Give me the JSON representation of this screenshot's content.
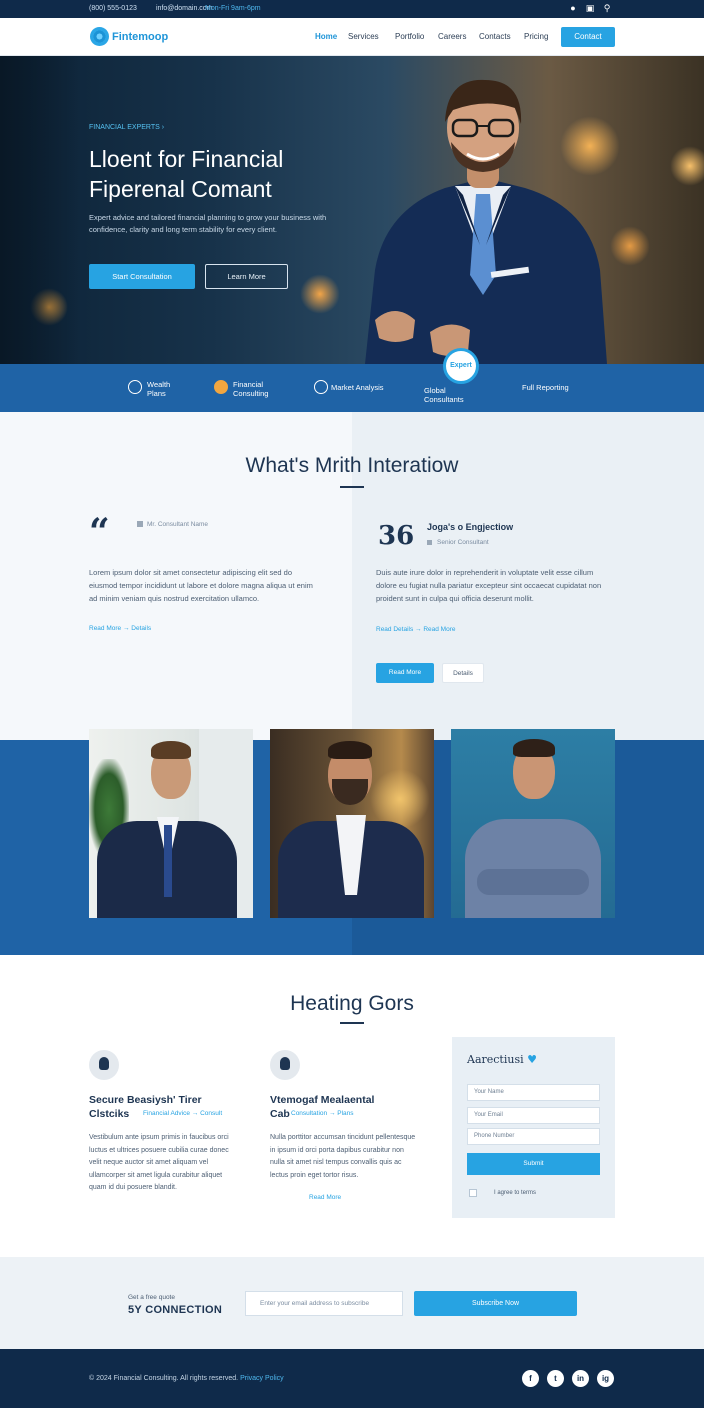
{
  "topbar": {
    "phone": "(800) 555-0123",
    "email": "info@domain.com",
    "hours": "Mon-Fri 9am-6pm",
    "icons": [
      "user-icon",
      "bag-icon",
      "search-icon"
    ]
  },
  "nav": {
    "logo": "Fintemoop",
    "items": [
      "Home",
      "Services",
      "Portfolio",
      "Careers",
      "Contacts",
      "Pricing"
    ],
    "cta": "Contact"
  },
  "hero": {
    "tag": "FINANCIAL EXPERTS ›",
    "title_line1": "Lloent for Financial",
    "title_line2": "Fiperenal Comant",
    "desc": "Expert advice and tailored financial planning to grow your business with confidence, clarity and long term stability for every client.",
    "btn_primary": "Start Consultation",
    "btn_secondary": "Learn More"
  },
  "strip": {
    "items": [
      "Wealth Plans",
      "Financial Consulting",
      "Market Analysis",
      "Global Consultants",
      "Full Reporting"
    ],
    "badge": "Expert"
  },
  "section_what": {
    "title": "What's Mrith Interatiow",
    "left": {
      "meta": "Mr. Consultant Name",
      "body": "Lorem ipsum dolor sit amet consectetur adipiscing elit sed do eiusmod tempor incididunt ut labore et dolore magna aliqua ut enim ad minim veniam quis nostrud exercitation ullamco.",
      "link": "Read More → Details"
    },
    "right": {
      "name": "Joga's o Engjectiow",
      "meta": "Senior Consultant",
      "body": "Duis aute irure dolor in reprehenderit in voluptate velit esse cillum dolore eu fugiat nulla pariatur excepteur sint occaecat cupidatat non proident sunt in culpa qui officia deserunt mollit.",
      "link": "Read Details → Read More",
      "btn_primary": "Read More",
      "btn_secondary": "Details"
    }
  },
  "section_heat": {
    "title": "Heating Gors",
    "svc1": {
      "title_line1": "Secure Beasiysh' Tirer",
      "title_line2": "Clstciks",
      "tag": "Financial Advice → Consult",
      "body": "Vestibulum ante ipsum primis in faucibus orci luctus et ultrices posuere cubilia curae donec velit neque auctor sit amet aliquam vel ullamcorper sit amet ligula curabitur aliquet quam id dui posuere blandit."
    },
    "svc2": {
      "title_line1": "Vtemogaf Mealaental",
      "title_line2": "Cab",
      "tag": "Consultation → Plans",
      "body": "Nulla porttitor accumsan tincidunt pellentesque in ipsum id orci porta dapibus curabitur non nulla sit amet nisl tempus convallis quis ac lectus proin eget tortor risus.",
      "link": "Read More"
    },
    "form": {
      "title": "Aarectiusi",
      "title_hl": "♥",
      "fields": [
        "Your Name",
        "Your Email",
        "Phone Number"
      ],
      "button": "Submit",
      "checkbox_label": "I agree to terms"
    }
  },
  "connection": {
    "small": "Get a free quote",
    "big": "5Y CONNECTION",
    "placeholder": "Enter your email address to subscribe",
    "button": "Subscribe Now"
  },
  "footer": {
    "copy": "© 2024 Financial Consulting. All rights reserved. ",
    "copy_link": "Privacy Policy",
    "social": [
      "f",
      "t",
      "in",
      "ig"
    ]
  },
  "colors": {
    "accent": "#27a3e2",
    "navy": "#0f2a4a",
    "band": "#1f63a6"
  }
}
